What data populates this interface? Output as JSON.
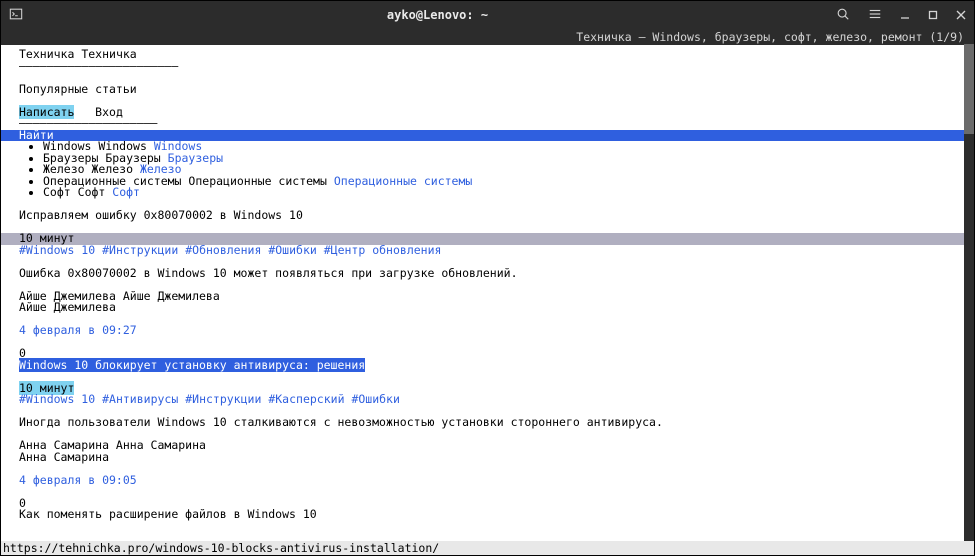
{
  "titlebar": {
    "title": "ayko@Lenovo: ~"
  },
  "topstatus": "Техничка — Windows, браузеры, софт, железо, ремонт (1/9)",
  "header": {
    "brand1": "Техничка",
    "brand2": "Техничка",
    "divider": "———————————————————————",
    "popular": "Популярные статьи",
    "write": "Написать",
    "login": "Вход",
    "divider2": "————————————————————",
    "search": "Найти"
  },
  "categories": [
    {
      "t1": "Windows",
      "t2": "Windows",
      "link": "Windows"
    },
    {
      "t1": "Браузеры",
      "t2": "Браузеры",
      "link": "Браузеры"
    },
    {
      "t1": "Железо",
      "t2": "Железо",
      "link": "Железо"
    },
    {
      "t1": "Операционные системы",
      "t2": "Операционные системы",
      "link": "Операционные системы"
    },
    {
      "t1": "Софт",
      "t2": "Софт",
      "link": "Софт"
    }
  ],
  "articles": [
    {
      "title": "Исправляем ошибку 0x80070002 в Windows 10",
      "read_time": "10 минут",
      "tags": [
        "#Windows 10",
        "#Инструкции",
        "#Обновления",
        "#Ошибки",
        "#Центр обновления"
      ],
      "summary": "Ошибка 0x80070002 в Windows 10 может появляться при загрузке обновлений.",
      "author_line1": "Айше Джемилева Айше Джемилева",
      "author_line2": "Айше Джемилева",
      "date": "4 февраля в 09:27",
      "zero": "0",
      "next_title": "Windows 10 блокирует установку антивируса: решения",
      "highlighted": false,
      "next_highlighted": true
    },
    {
      "read_time": "10 минут",
      "tags": [
        "#Windows 10",
        "#Антивирусы",
        "#Инструкции",
        "#Касперский",
        "#Ошибки"
      ],
      "summary": "Иногда пользователи Windows 10 сталкиваются с невозможностью установки стороннего антивируса.",
      "author_line1": "Анна Самарина Анна Самарина",
      "author_line2": "Анна Самарина",
      "date": "4 февраля в 09:05",
      "zero": "0",
      "next_title": "Как поменять расширение файлов в Windows 10",
      "read_time_highlighted": true
    }
  ],
  "statusbar": "https://tehnichka.pro/windows-10-blocks-antivirus-installation/"
}
